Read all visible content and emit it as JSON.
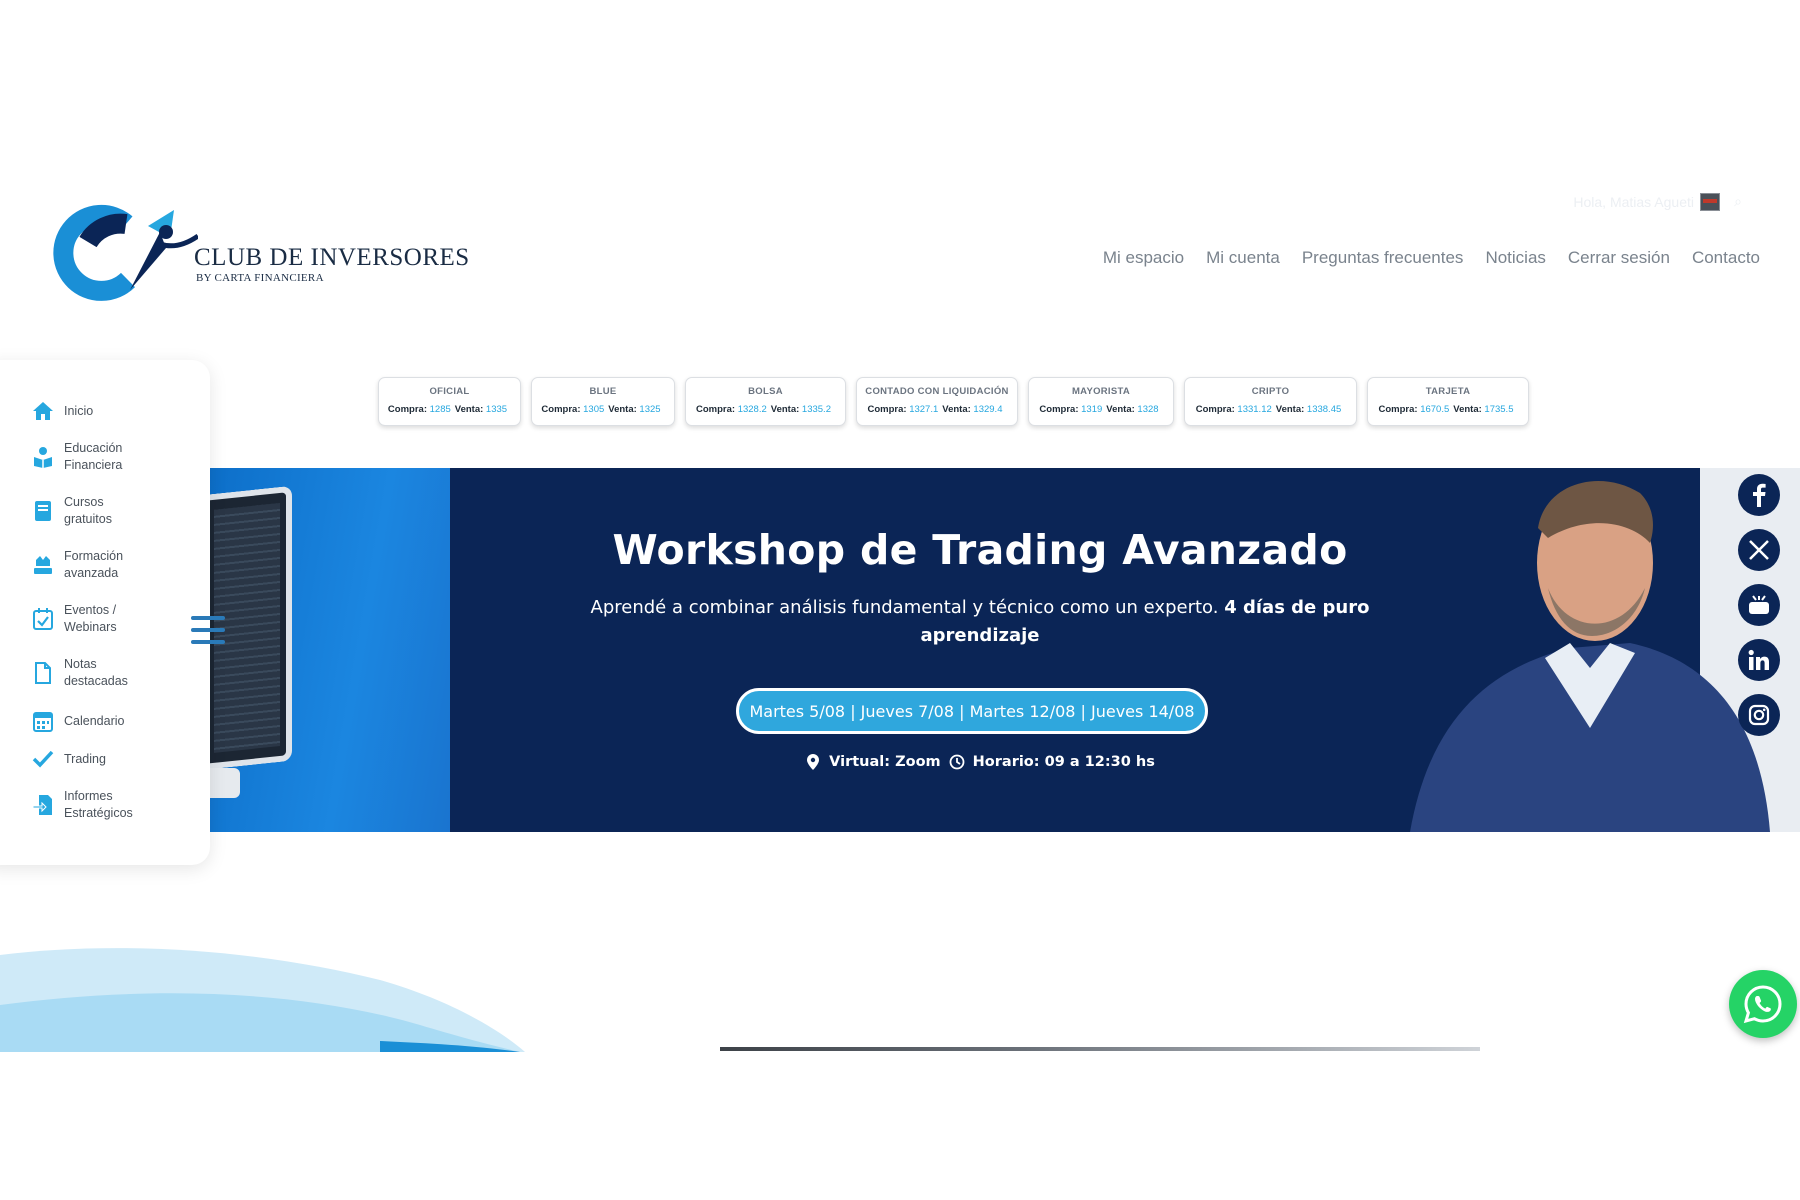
{
  "brand": {
    "title": "CLUB DE INVERSORES",
    "subtitle": "BY CARTA FINANCIERA",
    "colors": {
      "primary": "#26a7df",
      "navy": "#0b2556",
      "dark": "#1a2c44"
    }
  },
  "header": {
    "greeting": "Hola, Matias Agueti",
    "nav": [
      "Mi espacio",
      "Mi cuenta",
      "Preguntas frecuentes",
      "Noticias",
      "Cerrar sesión",
      "Contacto"
    ]
  },
  "sidebar": {
    "items": [
      {
        "label": "Inicio",
        "icon": "home-icon"
      },
      {
        "label": "Educación Financiera",
        "icon": "education-icon"
      },
      {
        "label": "Cursos gratuitos",
        "icon": "book-icon"
      },
      {
        "label": "Formación avanzada",
        "icon": "graduation-icon"
      },
      {
        "label": "Eventos / Webinars",
        "icon": "calendar-check-icon"
      },
      {
        "label": "Notas destacadas",
        "icon": "document-icon"
      },
      {
        "label": "Calendario",
        "icon": "calendar-icon"
      },
      {
        "label": "Trading",
        "icon": "check-icon"
      },
      {
        "label": "Informes Estratégicos",
        "icon": "report-icon"
      }
    ]
  },
  "rates": {
    "compra_label": "Compra:",
    "venta_label": "Venta:",
    "items": [
      {
        "name": "OFICIAL",
        "compra": "1285",
        "venta": "1335"
      },
      {
        "name": "BLUE",
        "compra": "1305",
        "venta": "1325"
      },
      {
        "name": "BOLSA",
        "compra": "1328.2",
        "venta": "1335.2"
      },
      {
        "name": "CONTADO CON LIQUIDACIÓN",
        "compra": "1327.1",
        "venta": "1329.4"
      },
      {
        "name": "MAYORISTA",
        "compra": "1319",
        "venta": "1328"
      },
      {
        "name": "CRIPTO",
        "compra": "1331.12",
        "venta": "1338.45"
      },
      {
        "name": "TARJETA",
        "compra": "1670.5",
        "venta": "1735.5"
      }
    ]
  },
  "banner": {
    "title": "Workshop de Trading Avanzado",
    "desc_plain": "Aprendé a combinar análisis fundamental y técnico como un experto.",
    "desc_bold": "4 días de puro aprendizaje",
    "dates": "Martes 5/08 | Jueves 7/08 | Martes 12/08 | Jueves 14/08",
    "location": "Virtual: Zoom",
    "schedule": "Horario: 09 a 12:30 hs"
  },
  "social": [
    "facebook-icon",
    "x-icon",
    "youtube-icon",
    "linkedin-icon",
    "instagram-icon"
  ]
}
